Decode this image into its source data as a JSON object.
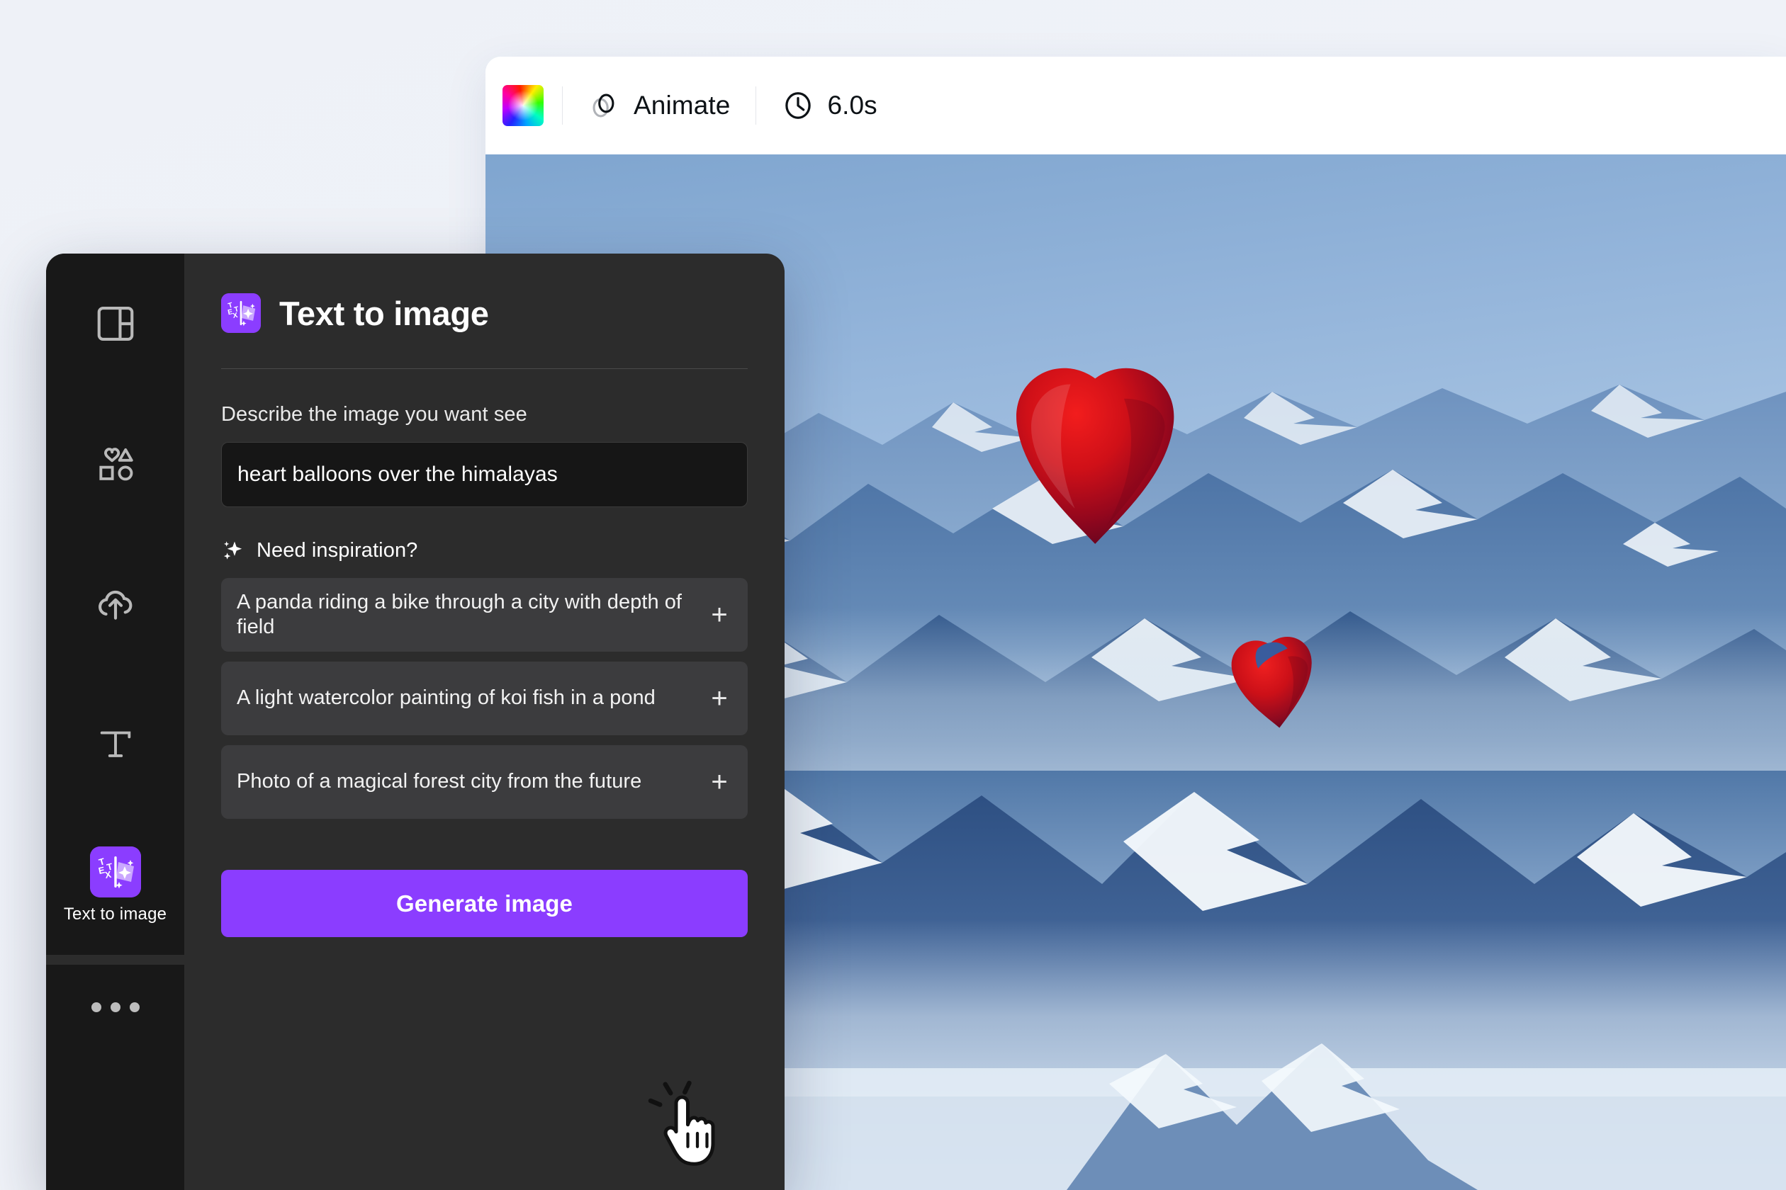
{
  "app": {
    "background_color": "#eff2f8",
    "accent_color": "#8b3dff"
  },
  "toolbar": {
    "color_swatch": {
      "icon": "rainbow-color-swatch",
      "label": ""
    },
    "animate": {
      "icon": "animate-icon",
      "label": "Animate"
    },
    "duration": {
      "icon": "clock-icon",
      "label": "6.0s"
    }
  },
  "canvas": {
    "alt": "Aerial photo of snow-capped Himalayan mountain ranges in blue haze with two red heart-shaped hot air balloons floating above the peaks"
  },
  "sidebar": {
    "items": [
      {
        "icon": "layout-design-icon",
        "label": "",
        "active": false
      },
      {
        "icon": "elements-shapes-icon",
        "label": "",
        "active": false
      },
      {
        "icon": "cloud-upload-icon",
        "label": "",
        "active": false
      },
      {
        "icon": "text-tool-icon",
        "label": "",
        "active": false
      },
      {
        "icon": "text-to-image-icon",
        "label": "Text to image",
        "active": true
      }
    ],
    "more": {
      "icon": "more-dots-icon",
      "label": ""
    }
  },
  "panel": {
    "icon": "text-to-image-icon",
    "title": "Text to image",
    "prompt": {
      "label": "Describe the image you want see",
      "value": "heart balloons over the himalayas",
      "placeholder": "Describe the image you want see"
    },
    "inspiration": {
      "icon": "sparkles-icon",
      "label": "Need inspiration?",
      "suggestions": [
        {
          "text": "A panda riding a bike through a city with depth of field",
          "add_label": "+"
        },
        {
          "text": "A light watercolor painting of koi fish in a pond",
          "add_label": "+"
        },
        {
          "text": "Photo of a magical forest city from the future",
          "add_label": "+"
        }
      ]
    },
    "generate_button": {
      "label": "Generate image"
    }
  },
  "cursor": {
    "icon": "pointing-hand-click-cursor"
  }
}
